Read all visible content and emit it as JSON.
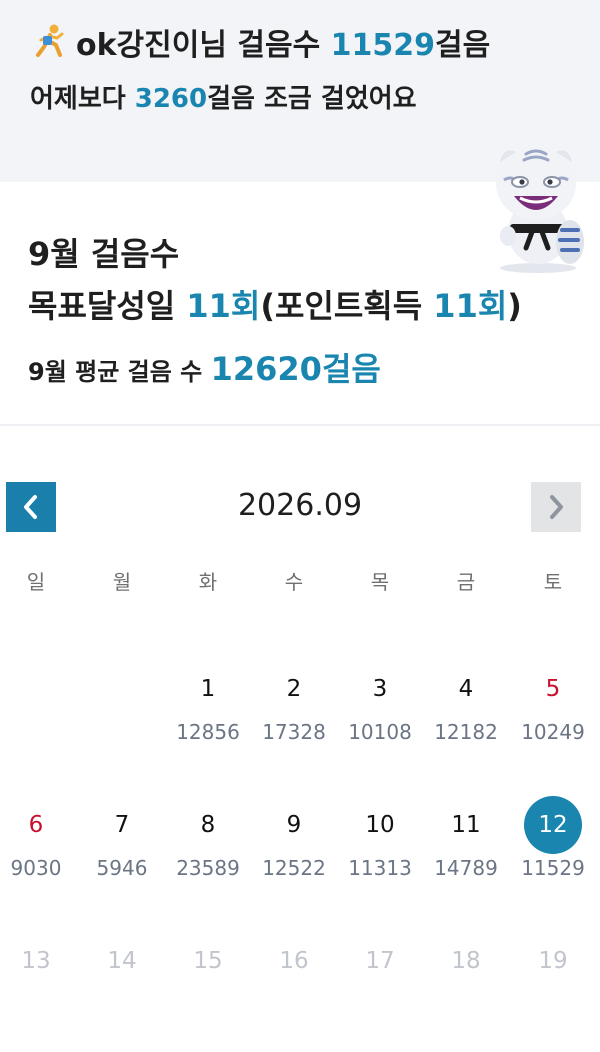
{
  "header": {
    "user_name": "ok강진이님 걸음수",
    "today_steps": "11529",
    "steps_unit": "걸음",
    "compare_prefix": "어제보다",
    "compare_value": "3260",
    "compare_suffix": "걸음 조금 걸었어요"
  },
  "summary": {
    "month_title": "9월 걸음수",
    "goal_label": "목표달성일",
    "goal_value": "11회",
    "point_label": "(포인트획득",
    "point_value": "11회",
    "point_close": ")",
    "avg_label": "9월 평균 걸음 수",
    "avg_value": "12620걸음"
  },
  "calendar": {
    "month": "2026.09",
    "weekdays": [
      "일",
      "월",
      "화",
      "수",
      "목",
      "금",
      "토"
    ],
    "weeks": [
      [
        {
          "day": "",
          "steps": ""
        },
        {
          "day": "",
          "steps": ""
        },
        {
          "day": "1",
          "steps": "12856"
        },
        {
          "day": "2",
          "steps": "17328"
        },
        {
          "day": "3",
          "steps": "10108"
        },
        {
          "day": "4",
          "steps": "12182"
        },
        {
          "day": "5",
          "steps": "10249"
        }
      ],
      [
        {
          "day": "6",
          "steps": "9030"
        },
        {
          "day": "7",
          "steps": "5946"
        },
        {
          "day": "8",
          "steps": "23589"
        },
        {
          "day": "9",
          "steps": "12522"
        },
        {
          "day": "10",
          "steps": "11313"
        },
        {
          "day": "11",
          "steps": "14789"
        },
        {
          "day": "12",
          "steps": "11529"
        }
      ],
      [
        {
          "day": "13",
          "steps": ""
        },
        {
          "day": "14",
          "steps": ""
        },
        {
          "day": "15",
          "steps": ""
        },
        {
          "day": "16",
          "steps": ""
        },
        {
          "day": "17",
          "steps": ""
        },
        {
          "day": "18",
          "steps": ""
        },
        {
          "day": "19",
          "steps": ""
        }
      ]
    ],
    "selected_day": "12",
    "colors": {
      "accent": "#1a86b0",
      "holiday": "#c8102e",
      "future": "#c2c5cc"
    }
  }
}
